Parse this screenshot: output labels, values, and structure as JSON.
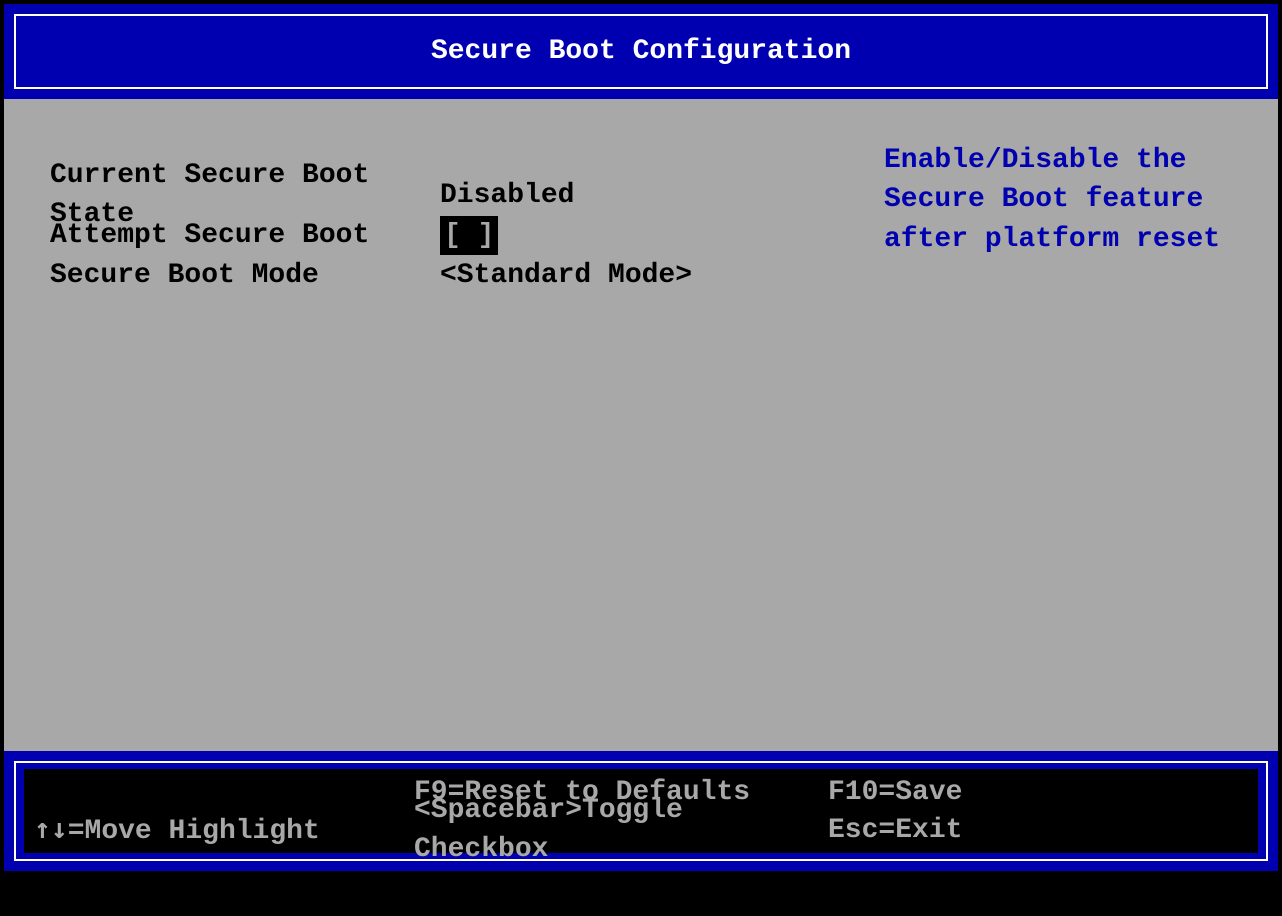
{
  "header": {
    "title": "Secure Boot Configuration"
  },
  "settings": {
    "rows": [
      {
        "label": "Current Secure Boot State",
        "value": "Disabled"
      },
      {
        "label": "Attempt Secure Boot",
        "checkbox": "[ ]"
      },
      {
        "label": "Secure Boot Mode",
        "value": "<Standard Mode>"
      }
    ]
  },
  "help": {
    "line1": "Enable/Disable the",
    "line2": "Secure Boot feature",
    "line3": "after platform reset"
  },
  "footer": {
    "row1": {
      "c1": "",
      "c2": "F9=Reset to Defaults",
      "c3": "F10=Save"
    },
    "row2": {
      "c1_arrows": "↑↓",
      "c1_text": "=Move Highlight",
      "c2": "<Spacebar>Toggle Checkbox",
      "c3": "Esc=Exit"
    }
  }
}
